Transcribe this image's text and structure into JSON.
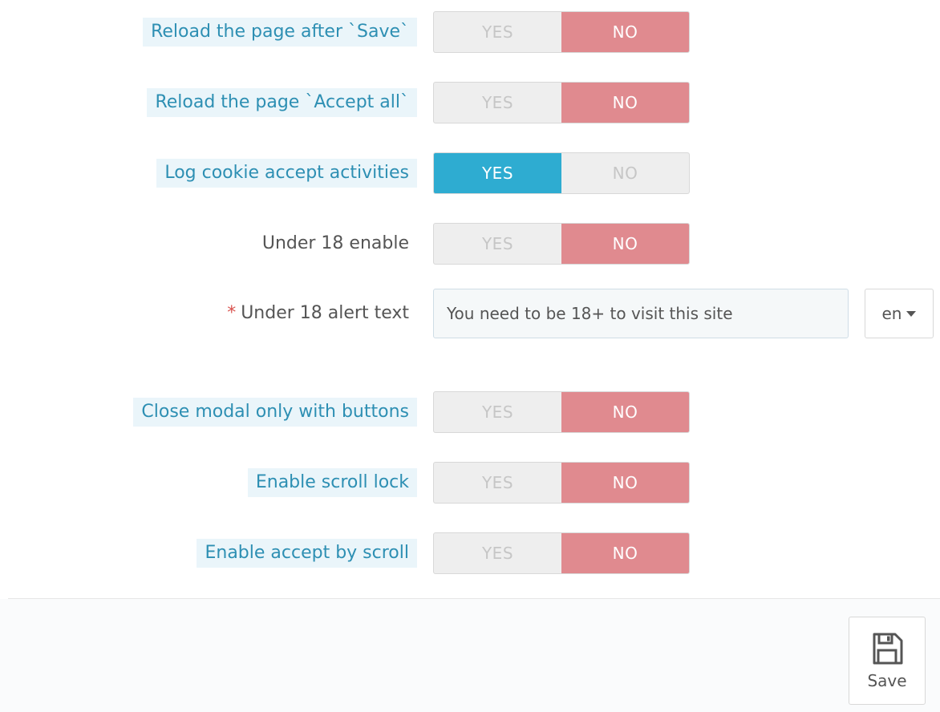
{
  "settings": [
    {
      "label": "Reload the page after `Save`",
      "hint": true,
      "type": "toggle",
      "value": "NO"
    },
    {
      "label": "Reload the page `Accept all`",
      "hint": true,
      "type": "toggle",
      "value": "NO"
    },
    {
      "label": "Log cookie accept activities",
      "hint": true,
      "type": "toggle",
      "value": "YES"
    },
    {
      "label": "Under 18 enable",
      "hint": false,
      "type": "toggle",
      "value": "NO"
    },
    {
      "label": "Under 18 alert text",
      "required": true,
      "type": "text",
      "value": "You need to be 18+ to visit this site",
      "language": "en"
    },
    {
      "label": "Close modal only with buttons",
      "hint": true,
      "type": "toggle",
      "value": "NO"
    },
    {
      "label": "Enable scroll lock",
      "hint": true,
      "type": "toggle",
      "value": "NO"
    },
    {
      "label": "Enable accept by scroll",
      "hint": true,
      "type": "toggle",
      "value": "NO"
    }
  ],
  "toggle_labels": {
    "yes": "YES",
    "no": "NO"
  },
  "required_marker": "*",
  "footer": {
    "save_label": "Save",
    "save_icon": "floppy-disk-icon"
  },
  "colors": {
    "no_active": "#e08a8f",
    "yes_active": "#2eacd1",
    "hint_text": "#2d8fb3",
    "hint_bg": "#eaf5fa",
    "required": "#d9534f"
  }
}
